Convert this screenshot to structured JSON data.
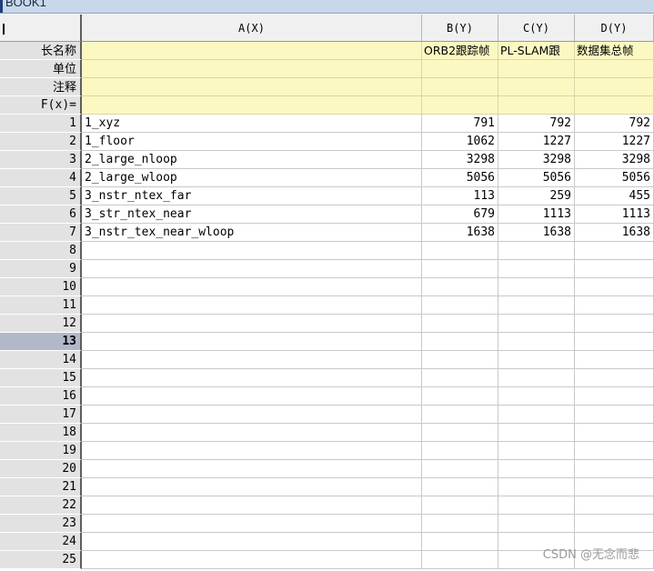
{
  "window": {
    "title": "BOOK1"
  },
  "columns": [
    {
      "header": ""
    },
    {
      "header": "A(X)"
    },
    {
      "header": "B(Y)"
    },
    {
      "header": "C(Y)"
    },
    {
      "header": "D(Y)"
    }
  ],
  "meta_rows": [
    {
      "label": "长名称",
      "values": [
        "",
        "ORB2跟踪帧",
        "PL-SLAM跟",
        "数据集总帧"
      ]
    },
    {
      "label": "单位",
      "values": [
        "",
        "",
        "",
        ""
      ]
    },
    {
      "label": "注释",
      "values": [
        "",
        "",
        "",
        ""
      ]
    },
    {
      "label": "F(x)=",
      "values": [
        "",
        "",
        "",
        ""
      ]
    }
  ],
  "rows": [
    {
      "num": "1",
      "a": "1_xyz",
      "b": "791",
      "c": "792",
      "d": "792"
    },
    {
      "num": "2",
      "a": "1_floor",
      "b": "1062",
      "c": "1227",
      "d": "1227"
    },
    {
      "num": "3",
      "a": "2_large_nloop",
      "b": "3298",
      "c": "3298",
      "d": "3298"
    },
    {
      "num": "4",
      "a": "2_large_wloop",
      "b": "5056",
      "c": "5056",
      "d": "5056"
    },
    {
      "num": "5",
      "a": "3_nstr_ntex_far",
      "b": "113",
      "c": "259",
      "d": "455"
    },
    {
      "num": "6",
      "a": "3_str_ntex_near",
      "b": "679",
      "c": "1113",
      "d": "1113"
    },
    {
      "num": "7",
      "a": "3_nstr_tex_near_wloop",
      "b": "1638",
      "c": "1638",
      "d": "1638"
    },
    {
      "num": "8",
      "a": "",
      "b": "",
      "c": "",
      "d": ""
    },
    {
      "num": "9",
      "a": "",
      "b": "",
      "c": "",
      "d": ""
    },
    {
      "num": "10",
      "a": "",
      "b": "",
      "c": "",
      "d": ""
    },
    {
      "num": "11",
      "a": "",
      "b": "",
      "c": "",
      "d": ""
    },
    {
      "num": "12",
      "a": "",
      "b": "",
      "c": "",
      "d": ""
    },
    {
      "num": "13",
      "a": "",
      "b": "",
      "c": "",
      "d": ""
    },
    {
      "num": "14",
      "a": "",
      "b": "",
      "c": "",
      "d": ""
    },
    {
      "num": "15",
      "a": "",
      "b": "",
      "c": "",
      "d": ""
    },
    {
      "num": "16",
      "a": "",
      "b": "",
      "c": "",
      "d": ""
    },
    {
      "num": "17",
      "a": "",
      "b": "",
      "c": "",
      "d": ""
    },
    {
      "num": "18",
      "a": "",
      "b": "",
      "c": "",
      "d": ""
    },
    {
      "num": "19",
      "a": "",
      "b": "",
      "c": "",
      "d": ""
    },
    {
      "num": "20",
      "a": "",
      "b": "",
      "c": "",
      "d": ""
    },
    {
      "num": "21",
      "a": "",
      "b": "",
      "c": "",
      "d": ""
    },
    {
      "num": "22",
      "a": "",
      "b": "",
      "c": "",
      "d": ""
    },
    {
      "num": "23",
      "a": "",
      "b": "",
      "c": "",
      "d": ""
    },
    {
      "num": "24",
      "a": "",
      "b": "",
      "c": "",
      "d": ""
    },
    {
      "num": "25",
      "a": "",
      "b": "",
      "c": "",
      "d": ""
    }
  ],
  "active_row": "13",
  "watermark": "CSDN @无念而悲",
  "colors": {
    "meta_fill": "#fbf8c2",
    "row_header": "#e2e2e2",
    "active_row_header": "#b3b8c9",
    "grid_line": "#c9c9c9"
  }
}
